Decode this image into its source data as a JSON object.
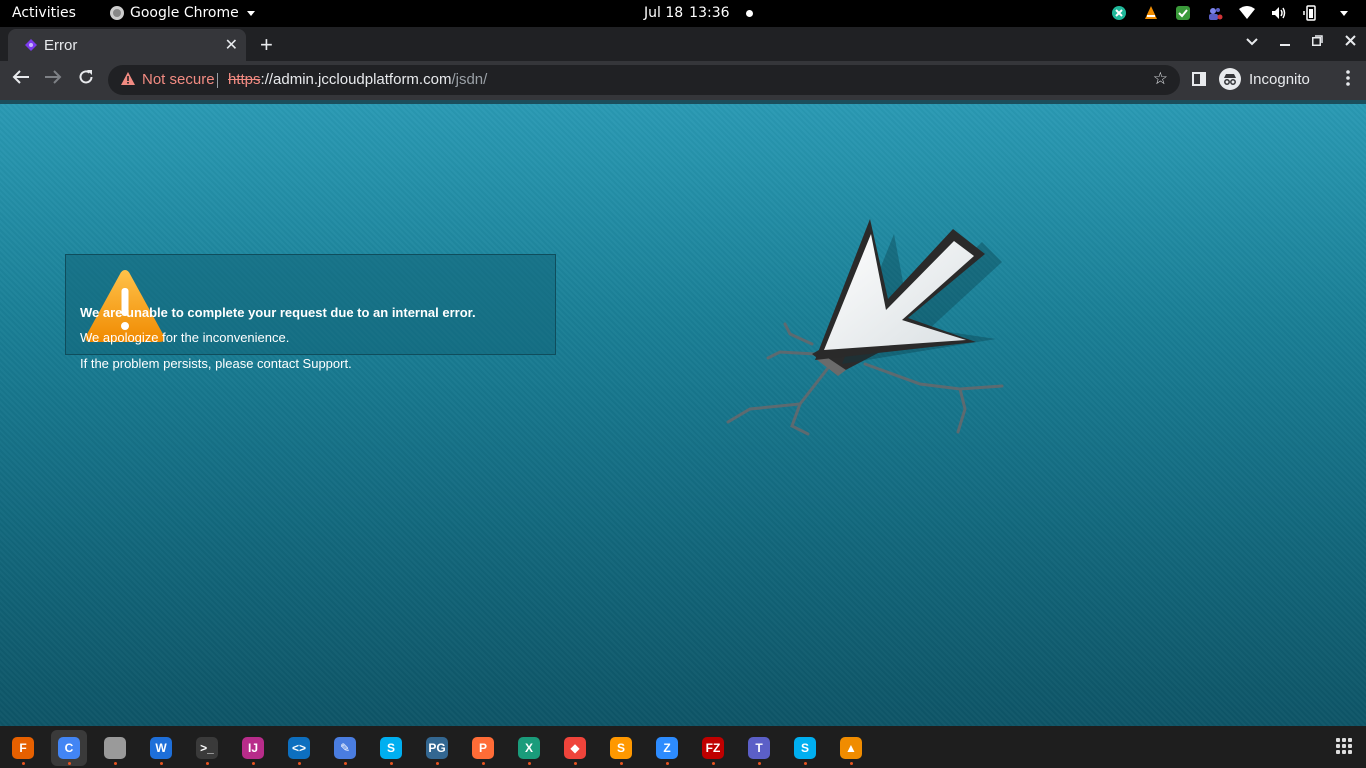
{
  "topbar": {
    "activities": "Activities",
    "app_name": "Google Chrome",
    "date": "Jul 18",
    "time": "13:36"
  },
  "tab": {
    "title": "Error",
    "close": "✕"
  },
  "toolbar": {
    "security_label": "Not secure",
    "url_scheme": "https",
    "url_host": "://admin.jccloudplatform.com",
    "url_path": "/jsdn/",
    "incognito_label": "Incognito"
  },
  "error": {
    "line1": "We are unable to complete your request due to an internal error.",
    "line2": "We apologize for the inconvenience.",
    "line3": "If the problem persists, please contact Support."
  },
  "dock": {
    "apps": [
      {
        "name": "Firefox",
        "color": "#e66000",
        "label": "F"
      },
      {
        "name": "Chrome",
        "color": "#4285f4",
        "label": "C"
      },
      {
        "name": "Files",
        "color": "#9a9a9a",
        "label": ""
      },
      {
        "name": "Writer",
        "color": "#1e6fd9",
        "label": "W"
      },
      {
        "name": "Terminal",
        "color": "#3a3a3a",
        "label": ">_"
      },
      {
        "name": "IntelliJ",
        "color": "#b82c8a",
        "label": "IJ"
      },
      {
        "name": "VS Code",
        "color": "#0d6fbf",
        "label": "<>"
      },
      {
        "name": "Text Editor",
        "color": "#4a7de0",
        "label": "✎"
      },
      {
        "name": "Skype",
        "color": "#00aff0",
        "label": "S"
      },
      {
        "name": "pgAdmin",
        "color": "#336791",
        "label": "PG"
      },
      {
        "name": "Postman",
        "color": "#ff6c37",
        "label": "P"
      },
      {
        "name": "CrossOver",
        "color": "#1a9c7b",
        "label": "X"
      },
      {
        "name": "AnyDesk",
        "color": "#ef443b",
        "label": "◆"
      },
      {
        "name": "Sublime Text",
        "color": "#ff9800",
        "label": "S"
      },
      {
        "name": "Zoom",
        "color": "#2d8cff",
        "label": "Z"
      },
      {
        "name": "FileZilla",
        "color": "#bf0000",
        "label": "FZ"
      },
      {
        "name": "Teams",
        "color": "#5b5fc7",
        "label": "T"
      },
      {
        "name": "Skype 2",
        "color": "#00aff0",
        "label": "S"
      },
      {
        "name": "VLC",
        "color": "#f08c00",
        "label": "▲"
      }
    ]
  }
}
